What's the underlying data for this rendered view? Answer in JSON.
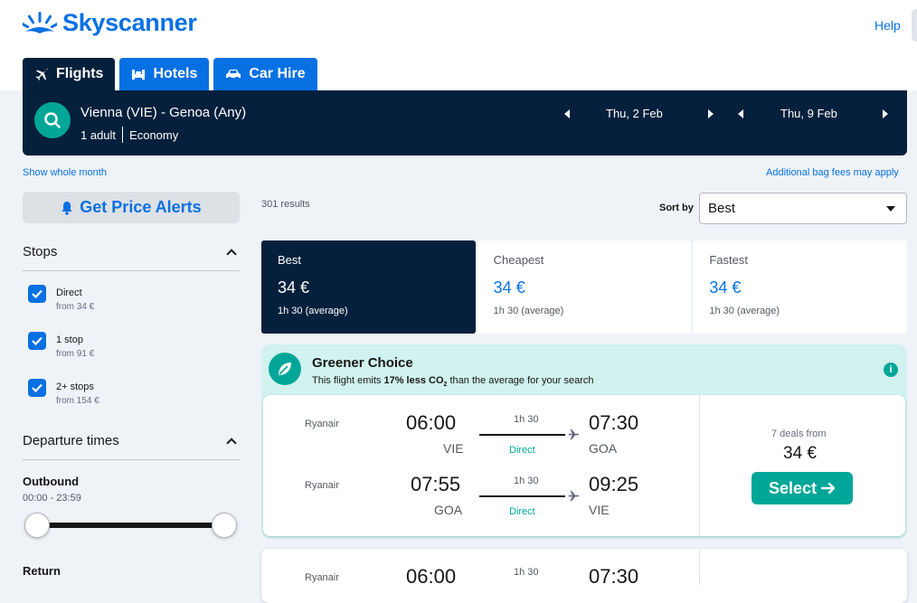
{
  "brand": {
    "name": "Skyscanner"
  },
  "header": {
    "help_label": "Help"
  },
  "tabs": [
    {
      "label": "Flights",
      "icon": "plane-icon",
      "active": true
    },
    {
      "label": "Hotels",
      "icon": "bed-icon",
      "active": false
    },
    {
      "label": "Car Hire",
      "icon": "car-icon",
      "active": false
    }
  ],
  "search": {
    "route": "Vienna (VIE) - Genoa (Any)",
    "passengers": "1 adult",
    "cabin": "Economy",
    "depart_date": "Thu, 2 Feb",
    "return_date": "Thu, 9 Feb"
  },
  "links": {
    "show_month": "Show whole month",
    "bag_fees": "Additional bag fees may apply"
  },
  "sidebar": {
    "price_alerts_label": "Get Price Alerts",
    "stops": {
      "title": "Stops",
      "options": [
        {
          "label": "Direct",
          "from": "from 34 €",
          "checked": true
        },
        {
          "label": "1 stop",
          "from": "from 91 €",
          "checked": true
        },
        {
          "label": "2+ stops",
          "from": "from 154 €",
          "checked": true
        }
      ]
    },
    "departure_times": {
      "title": "Departure times",
      "outbound_title": "Outbound",
      "outbound_range": "00:00 - 23:59",
      "return_title": "Return"
    }
  },
  "results": {
    "count": "301 results",
    "sort_label": "Sort by",
    "sort_value": "Best"
  },
  "sort_tabs": [
    {
      "name": "Best",
      "price": "34 €",
      "duration": "1h 30 (average)",
      "active": true
    },
    {
      "name": "Cheapest",
      "price": "34 €",
      "duration": "1h 30 (average)",
      "active": false
    },
    {
      "name": "Fastest",
      "price": "34 €",
      "duration": "1h 30 (average)",
      "active": false
    }
  ],
  "green_choice": {
    "title": "Greener Choice",
    "subtitle_pre": "This flight emits ",
    "subtitle_bold": "17% less CO",
    "subtitle_sub": "2",
    "subtitle_post": " than the average for your search",
    "info_icon": "i"
  },
  "flight": {
    "outbound": {
      "airline": "Ryanair",
      "dep_time": "06:00",
      "dep_code": "VIE",
      "duration": "1h 30",
      "stops": "Direct",
      "arr_time": "07:30",
      "arr_code": "GOA"
    },
    "inbound": {
      "airline": "Ryanair",
      "dep_time": "07:55",
      "dep_code": "GOA",
      "duration": "1h 30",
      "stops": "Direct",
      "arr_time": "09:25",
      "arr_code": "VIE"
    },
    "deals": "7 deals from",
    "price": "34 €",
    "select_label": "Select"
  },
  "next_flight": {
    "airline": "Ryanair",
    "dep_time": "06:00",
    "duration": "1h 30",
    "arr_time": "07:30"
  },
  "colors": {
    "brand_blue": "#0770e3",
    "navy": "#05203c",
    "teal": "#00a698",
    "green_bg": "#d1f2ee"
  }
}
